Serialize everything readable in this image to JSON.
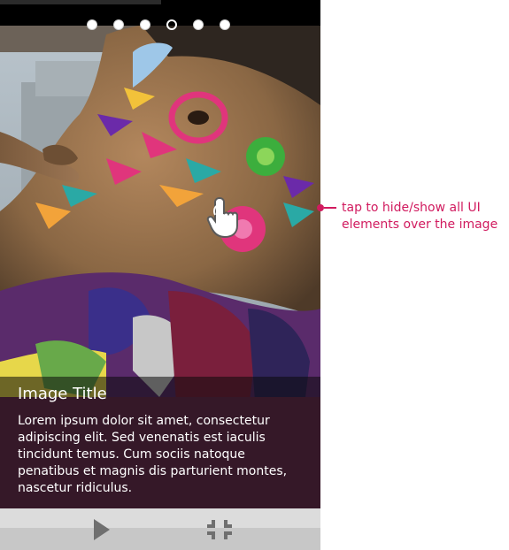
{
  "pager": {
    "count": 6,
    "active_index": 3
  },
  "caption": {
    "title": "Image Title",
    "body": "Lorem ipsum dolor sit amet, consectetur adipiscing elit. Sed venenatis est iaculis tincidunt temus. Cum sociis natoque penatibus et magnis dis parturient montes, nascetur ridiculus."
  },
  "annotation": {
    "text_line1": "tap to hide/show all UI",
    "text_line2": "elements over the image"
  },
  "icons": {
    "play": "play-icon",
    "collapse": "collapse-icon",
    "tap_hand": "tap-hand-icon"
  },
  "colors": {
    "annotation": "#d11b5f",
    "bottom_bar": "#c7c7c7",
    "top_bar": "#000000"
  }
}
